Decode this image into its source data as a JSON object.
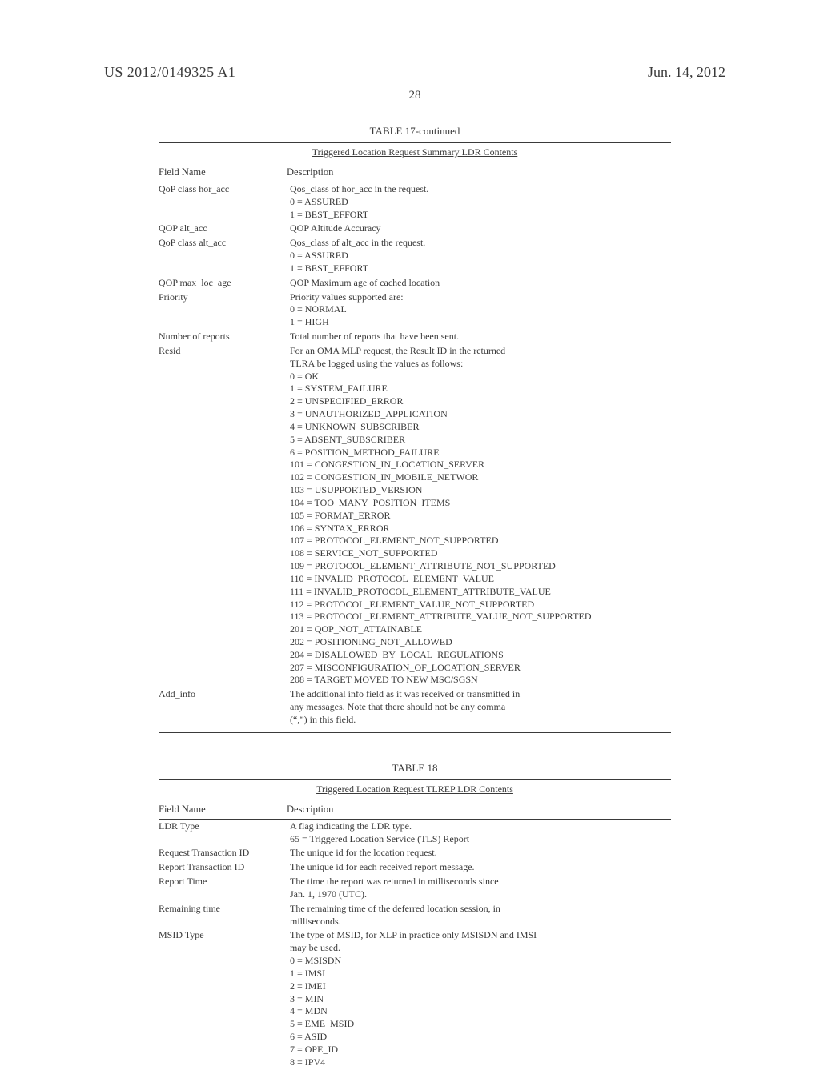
{
  "header": {
    "pubnum": "US 2012/0149325 A1",
    "date": "Jun. 14, 2012"
  },
  "page_number": "28",
  "table17": {
    "title": "TABLE 17-continued",
    "caption": "Triggered Location Request Summary LDR Contents",
    "colhead": {
      "c1": "Field Name",
      "c2": "Description"
    },
    "rows": [
      {
        "name": "QoP class hor_acc",
        "desc": [
          "Qos_class of hor_acc in the request.",
          "0 = ASSURED",
          "1 = BEST_EFFORT"
        ]
      },
      {
        "name": "QOP alt_acc",
        "desc": [
          "QOP Altitude Accuracy"
        ]
      },
      {
        "name": "QoP class alt_acc",
        "desc": [
          "Qos_class of alt_acc in the request.",
          "0 = ASSURED",
          "1 = BEST_EFFORT"
        ]
      },
      {
        "name": "QOP max_loc_age",
        "desc": [
          "QOP Maximum age of cached location"
        ]
      },
      {
        "name": "Priority",
        "desc": [
          "Priority values supported are:",
          "0 = NORMAL",
          "1 = HIGH"
        ]
      },
      {
        "name": "Number of reports",
        "desc": [
          "Total number of reports that have been sent."
        ]
      },
      {
        "name": "Resid",
        "desc": [
          "For an OMA MLP request, the Result ID in the returned",
          "TLRA be logged using the values as follows:",
          "0 = OK",
          "1 = SYSTEM_FAILURE",
          "2 = UNSPECIFIED_ERROR",
          "3 = UNAUTHORIZED_APPLICATION",
          "4 = UNKNOWN_SUBSCRIBER",
          "5 = ABSENT_SUBSCRIBER",
          "6 = POSITION_METHOD_FAILURE",
          "101 = CONGESTION_IN_LOCATION_SERVER",
          "102 = CONGESTION_IN_MOBILE_NETWOR",
          "103 = USUPPORTED_VERSION",
          "104 = TOO_MANY_POSITION_ITEMS",
          "105 = FORMAT_ERROR",
          "106 = SYNTAX_ERROR",
          "107 = PROTOCOL_ELEMENT_NOT_SUPPORTED",
          "108 = SERVICE_NOT_SUPPORTED",
          "109 = PROTOCOL_ELEMENT_ATTRIBUTE_NOT_SUPPORTED",
          "110 = INVALID_PROTOCOL_ELEMENT_VALUE",
          "111 = INVALID_PROTOCOL_ELEMENT_ATTRIBUTE_VALUE",
          "112 = PROTOCOL_ELEMENT_VALUE_NOT_SUPPORTED",
          "113 = PROTOCOL_ELEMENT_ATTRIBUTE_VALUE_NOT_SUPPORTED",
          "201 = QOP_NOT_ATTAINABLE",
          "202 = POSITIONING_NOT_ALLOWED",
          "204 = DISALLOWED_BY_LOCAL_REGULATIONS",
          "207 = MISCONFIGURATION_OF_LOCATION_SERVER",
          "208 = TARGET MOVED TO NEW MSC/SGSN"
        ]
      },
      {
        "name": "Add_info",
        "desc": [
          "The additional info field as it was received or transmitted in",
          "any messages. Note that there should not be any comma",
          "(“,”) in this field."
        ]
      }
    ]
  },
  "table18": {
    "title": "TABLE 18",
    "caption": "Triggered Location Request TLREP LDR Contents",
    "colhead": {
      "c1": "Field Name",
      "c2": "Description"
    },
    "rows": [
      {
        "name": "LDR Type",
        "desc": [
          "A flag indicating the LDR type.",
          "65 = Triggered Location Service (TLS) Report"
        ]
      },
      {
        "name": "Request Transaction ID",
        "desc": [
          "The unique id for the location request."
        ]
      },
      {
        "name": "Report Transaction ID",
        "desc": [
          "The unique id for each received report message."
        ]
      },
      {
        "name": "Report Time",
        "desc": [
          "The time the report was returned in milliseconds since",
          "Jan. 1, 1970 (UTC)."
        ]
      },
      {
        "name": "Remaining time",
        "desc": [
          "The remaining time of the deferred location session, in",
          "milliseconds."
        ]
      },
      {
        "name": "MSID Type",
        "desc": [
          "The type of MSID, for XLP in practice only MSISDN and IMSI",
          "may be used.",
          "0 = MSISDN",
          "1 = IMSI",
          "2 = IMEI",
          "3 = MIN",
          "4 = MDN",
          "5 = EME_MSID",
          "6 = ASID",
          "7 = OPE_ID",
          "8 = IPV4"
        ]
      }
    ]
  }
}
